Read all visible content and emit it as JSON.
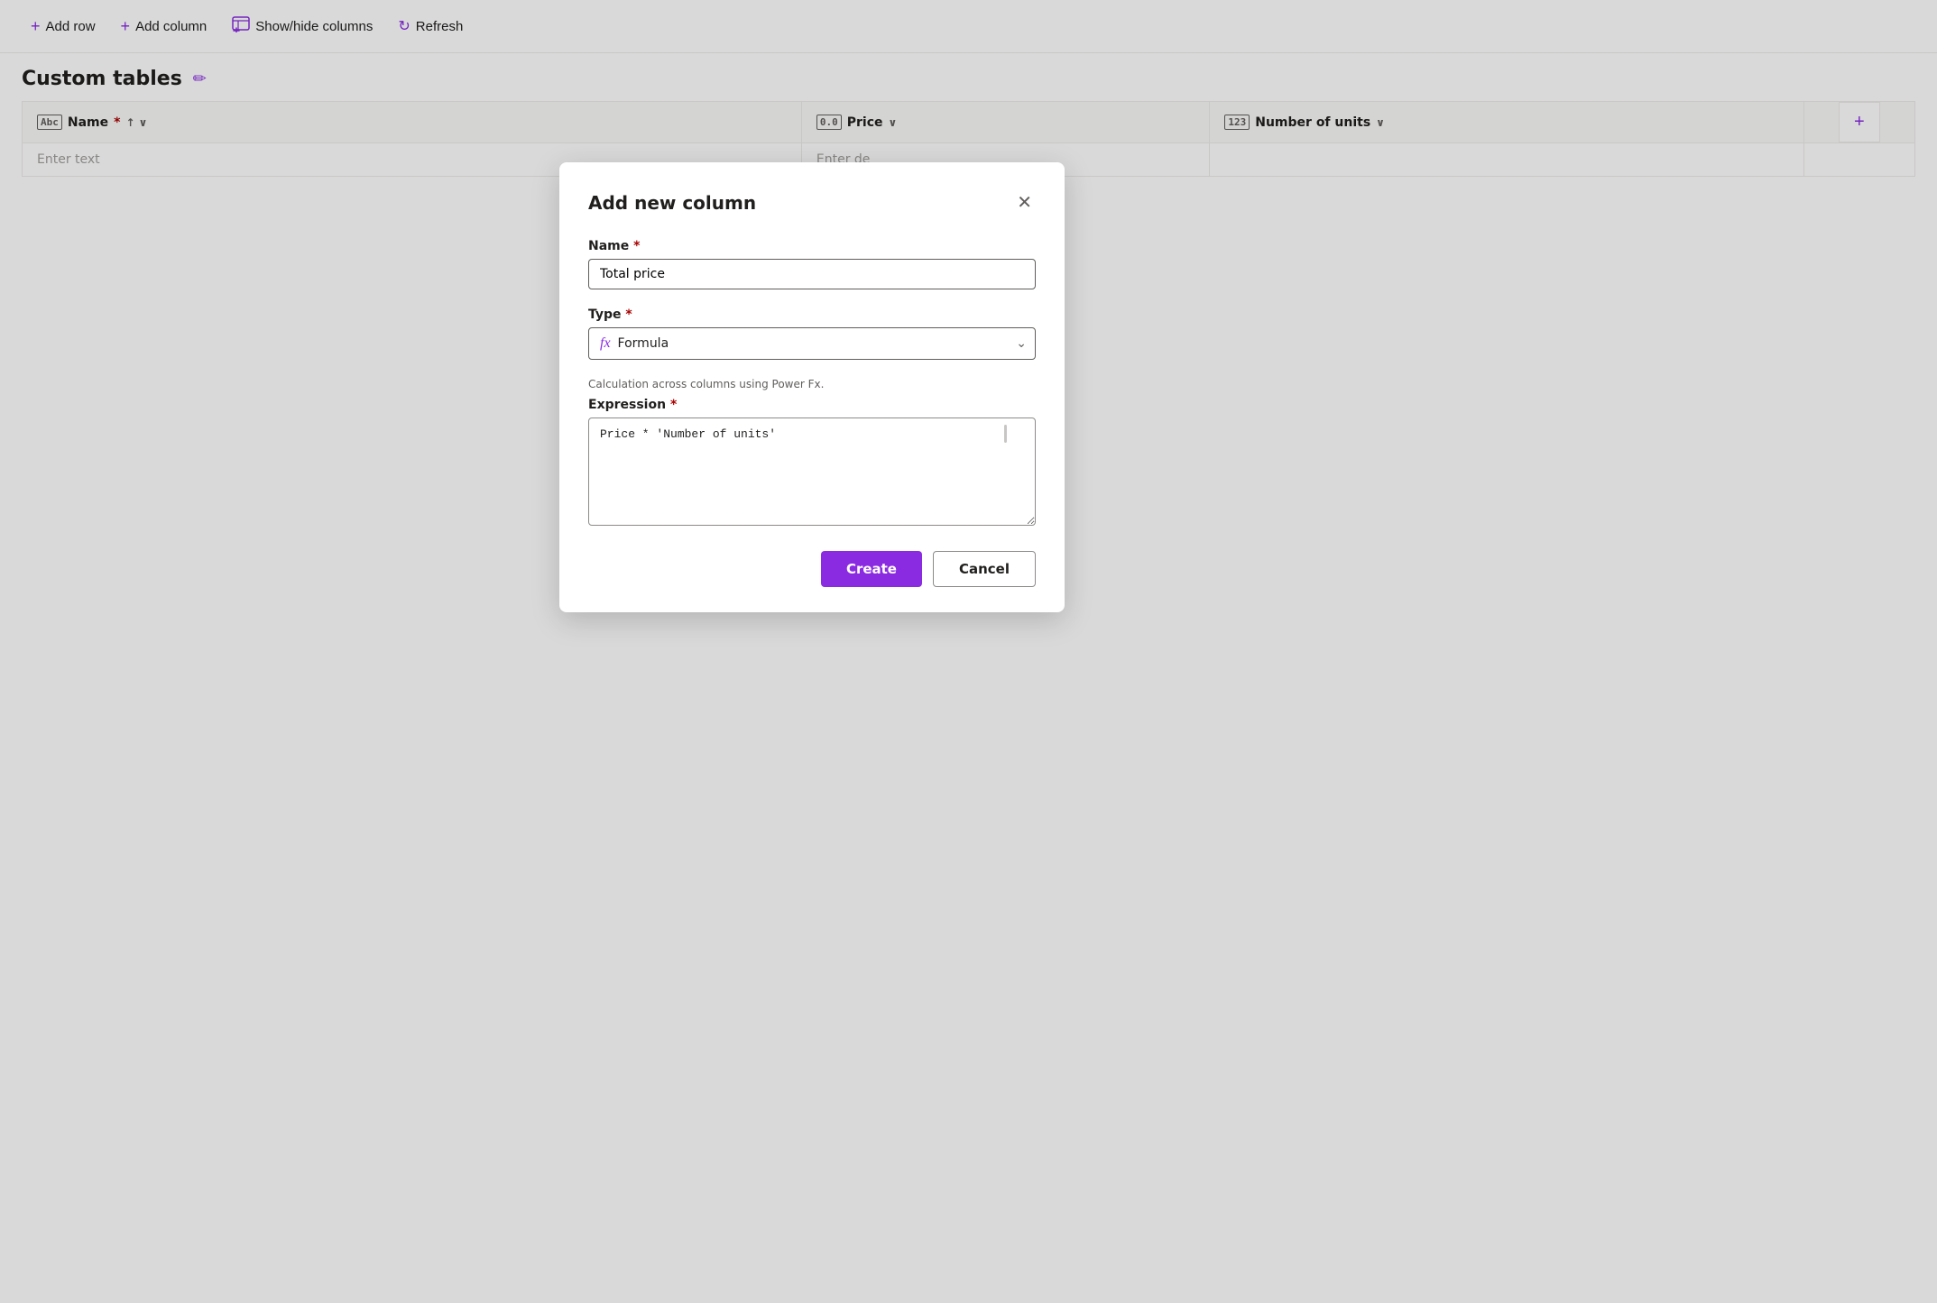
{
  "toolbar": {
    "add_row_label": "Add row",
    "add_column_label": "Add column",
    "show_hide_label": "Show/hide columns",
    "refresh_label": "Refresh"
  },
  "page": {
    "title": "Custom tables",
    "edit_icon_label": "✏"
  },
  "table": {
    "columns": [
      {
        "id": "name",
        "type_icon": "Abc",
        "label": "Name",
        "required": true,
        "sortable": true
      },
      {
        "id": "price",
        "type_icon": "0.0",
        "label": "Price",
        "required": false,
        "sortable": false
      },
      {
        "id": "units",
        "type_icon": "123",
        "label": "Number of units",
        "required": false,
        "sortable": false
      }
    ],
    "rows": [
      {
        "name_placeholder": "Enter text",
        "price_placeholder": "Enter de",
        "units_placeholder": ""
      }
    ],
    "add_col_icon": "+"
  },
  "modal": {
    "title": "Add new column",
    "close_icon": "✕",
    "name_label": "Name",
    "name_required": "*",
    "name_value": "Total price",
    "name_placeholder": "",
    "type_label": "Type",
    "type_required": "*",
    "type_fx_icon": "fx",
    "type_value": "Formula",
    "type_hint": "Calculation across columns using Power Fx.",
    "expression_label": "Expression",
    "expression_required": "*",
    "expression_value": "Price * 'Number of units'",
    "create_label": "Create",
    "cancel_label": "Cancel"
  }
}
